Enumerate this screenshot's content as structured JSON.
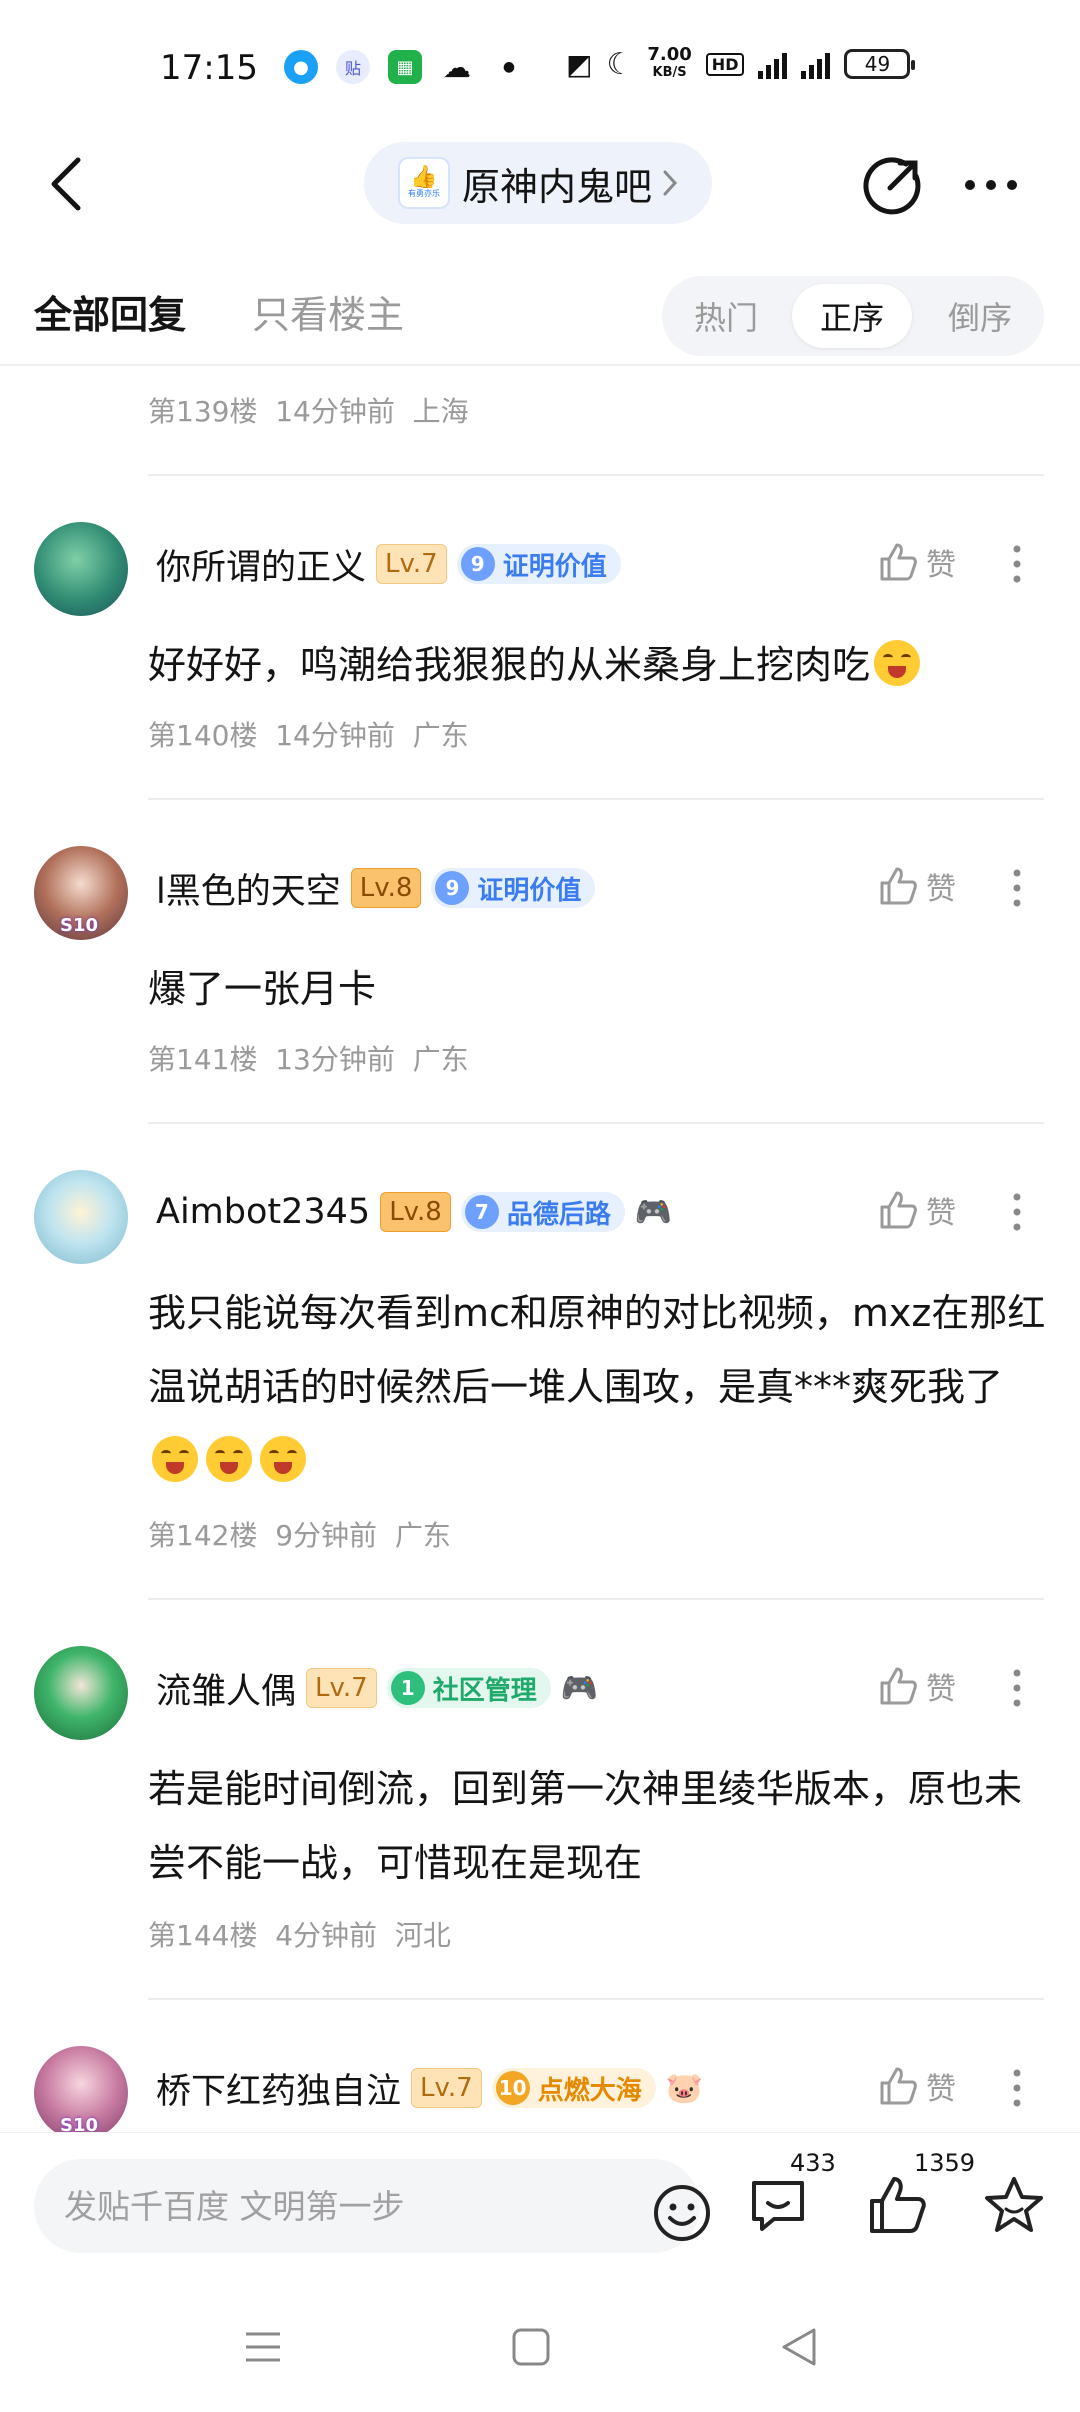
{
  "status_bar": {
    "time": "17:15",
    "net_speed_top": "7.00",
    "net_speed_unit": "KB/S",
    "hd_label": "HD",
    "battery": "49",
    "icons": [
      "qq-icon",
      "tieba-icon",
      "app-icon",
      "wechat-icon",
      "dot-icon",
      "nfc-icon",
      "moon-icon",
      "signal-5g-icon"
    ]
  },
  "nav": {
    "forum_name": "原神内鬼吧",
    "logo_tiny": "有勇亦乐"
  },
  "tabs": {
    "all_replies": "全部回复",
    "op_only": "只看楼主",
    "sort": [
      "热门",
      "正序",
      "倒序"
    ],
    "sort_active": "正序"
  },
  "feed": {
    "top_meta": "第139楼  14分钟前  上海",
    "like_label": "赞",
    "posts": [
      {
        "username": "你所谓的正义",
        "level": "Lv.7",
        "badge_num": "9",
        "badge_text": "证明价值",
        "text_parts": [
          "好好好，鸣潮给我狠狠的从米桑身上挖肉吃"
        ],
        "meta": "第140楼  14分钟前  广东"
      },
      {
        "username": "l黑色的天空",
        "level": "Lv.8",
        "badge_num": "9",
        "badge_text": "证明价值",
        "avatar_tag": "S10",
        "text_parts": [
          "爆了一张月卡"
        ],
        "meta": "第141楼  13分钟前  广东"
      },
      {
        "username": "Aimbot2345",
        "level": "Lv.8",
        "badge_num": "7",
        "badge_text": "品德后路",
        "text_parts": [
          "我只能说每次看到mc和原神的对比视频，mxz在那红温说胡话的时候然后一堆人围攻，是真***爽死我了"
        ],
        "meta": "第142楼  9分钟前  广东"
      },
      {
        "username": "流雏人偶",
        "level": "Lv.7",
        "badge_num": "1",
        "badge_text": "社区管理",
        "text_parts": [
          "若是能时间倒流，回到第一次神里绫华版本，原也未尝不能一战，可惜现在是现在"
        ],
        "meta": "第144楼  4分钟前  河北"
      },
      {
        "username": "桥下红药独自泣",
        "level": "Lv.7",
        "badge_num": "10",
        "badge_text": "点燃大海",
        "avatar_tag": "S10"
      }
    ]
  },
  "compose": {
    "placeholder": "发贴千百度 文明第一步",
    "comment_count": "433",
    "like_count": "1359"
  },
  "colors": {
    "accent_blue": "#3b7df0",
    "text_primary": "#141414",
    "text_secondary": "#9a9a9a",
    "divider": "#ececec"
  }
}
